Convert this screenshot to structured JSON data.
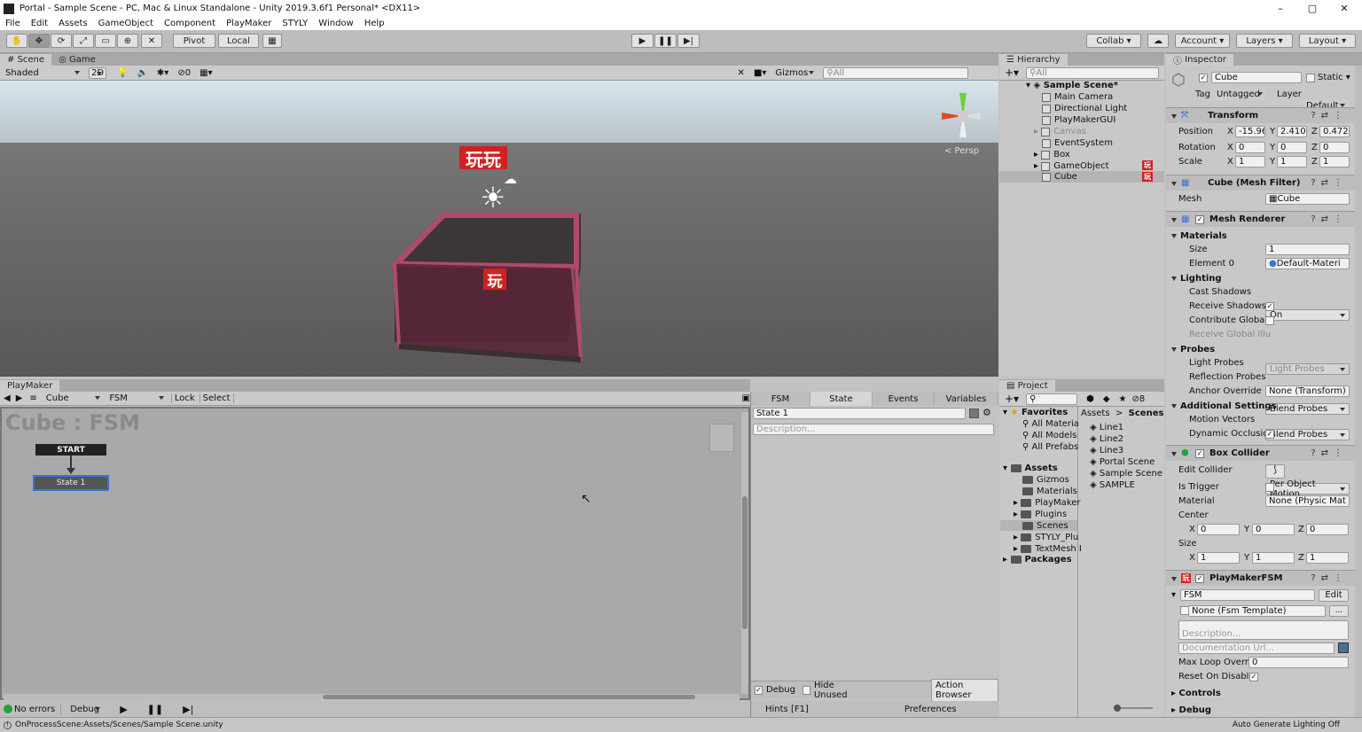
{
  "window": {
    "title": "Portal - Sample Scene - PC, Mac & Linux Standalone - Unity 2019.3.6f1 Personal* <DX11>",
    "minimize": "–",
    "maximize": "▢",
    "close": "✕"
  },
  "menu": [
    "File",
    "Edit",
    "Assets",
    "GameObject",
    "Component",
    "PlayMaker",
    "STYLY",
    "Window",
    "Help"
  ],
  "toolbar": {
    "pivot": "Pivot",
    "local": "Local",
    "collab": "Collab",
    "account": "Account",
    "layers": "Layers",
    "layout": "Layout"
  },
  "scene_panel": {
    "tabs": [
      "Scene",
      "Game"
    ],
    "shading": "Shaded",
    "mode2d": "2D",
    "hidden_count": "0",
    "gizmos": "Gizmos",
    "search_placeholder": "All",
    "persp": "< Persp",
    "badge_text": "玩玩",
    "badge_small": "玩"
  },
  "hierarchy": {
    "tab": "Hierarchy",
    "search_placeholder": "All",
    "scene": "Sample Scene*",
    "items": [
      "Main Camera",
      "Directional Light",
      "PlayMakerGUI",
      "Canvas",
      "EventSystem",
      "Box",
      "GameObject",
      "Cube"
    ],
    "badge": "玩"
  },
  "project": {
    "tab": "Project",
    "favorites": "Favorites",
    "fav_items": [
      "All Materia",
      "All Models",
      "All Prefabs"
    ],
    "assets": "Assets",
    "asset_folders": [
      "Gizmos",
      "Materials",
      "PlayMaker",
      "Plugins",
      "Scenes",
      "STYLY_Plu",
      "TextMesh I"
    ],
    "packages": "Packages",
    "breadcrumb_root": "Assets",
    "breadcrumb_sep": ">",
    "breadcrumb_leaf": "Scenes",
    "files": [
      "Line1",
      "Line2",
      "Line3",
      "Portal Scene",
      "Sample Scene",
      "SAMPLE"
    ],
    "count": "8"
  },
  "playmaker": {
    "tab": "PlayMaker",
    "object": "Cube",
    "fsm": "FSM",
    "lock": "Lock",
    "select": "Select",
    "graph_title": "Cube : FSM",
    "start": "START",
    "state": "State 1",
    "tabs": [
      "FSM",
      "State",
      "Events",
      "Variables"
    ],
    "state_name": "State 1",
    "description_placeholder": "Description...",
    "debug": "Debug",
    "hide_unused": "Hide Unused",
    "action_browser": "Action Browser",
    "hints": "Hints [F1]",
    "preferences": "Preferences",
    "no_errors": "No errors",
    "debug_menu": "Debug"
  },
  "inspector": {
    "tab": "Inspector",
    "object_name": "Cube",
    "static": "Static",
    "tag_label": "Tag",
    "tag": "Untagged",
    "layer_label": "Layer",
    "layer": "Default",
    "transform": {
      "title": "Transform",
      "position": "Position",
      "rotation": "Rotation",
      "scale": "Scale",
      "pos": [
        "-15.96",
        "2.4104",
        "0.4723"
      ],
      "rot": [
        "0",
        "0",
        "0"
      ],
      "scl": [
        "1",
        "1",
        "1"
      ]
    },
    "mesh_filter": {
      "title": "Cube (Mesh Filter)",
      "mesh_label": "Mesh",
      "mesh": "Cube"
    },
    "mesh_renderer": {
      "title": "Mesh Renderer",
      "materials": "Materials",
      "size_label": "Size",
      "size": "1",
      "element0_label": "Element 0",
      "element0": "Default-Materi",
      "lighting": "Lighting",
      "cast_shadows_label": "Cast Shadows",
      "cast_shadows": "On",
      "receive_shadows": "Receive Shadows",
      "contribute_gi": "Contribute Global I",
      "receive_gi_label": "Receive Global Illu",
      "receive_gi": "Light Probes",
      "probes": "Probes",
      "light_probes_label": "Light Probes",
      "light_probes": "Blend Probes",
      "reflection_probes_label": "Reflection Probes",
      "reflection_probes": "Blend Probes",
      "anchor_override_label": "Anchor Override",
      "anchor_override": "None (Transform)",
      "additional": "Additional Settings",
      "motion_vectors_label": "Motion Vectors",
      "motion_vectors": "Per Object Motion",
      "dynamic_occlusion": "Dynamic Occlusio"
    },
    "box_collider": {
      "title": "Box Collider",
      "edit_collider": "Edit Collider",
      "is_trigger": "Is Trigger",
      "material_label": "Material",
      "material": "None (Physic Mat",
      "center": "Center",
      "center_vals": [
        "0",
        "0",
        "0"
      ],
      "size": "Size",
      "size_vals": [
        "1",
        "1",
        "1"
      ]
    },
    "playmaker_fsm": {
      "title": "PlayMakerFSM",
      "fsm_name": "FSM",
      "edit": "Edit",
      "template": "None (Fsm Template)",
      "more": "...",
      "description_placeholder": "Description...",
      "doc_url_placeholder": "Documentation Url...",
      "max_loop_label": "Max Loop Overric",
      "max_loop": "0",
      "reset_on_disable": "Reset On Disable"
    },
    "controls": "Controls",
    "debug": "Debug",
    "auto_lighting": "Auto Generate Lighting Off"
  },
  "status": {
    "message": "OnProcessScene:Assets/Scenes/Sample Scene.unity"
  },
  "axes": {
    "x": "X",
    "y": "Y",
    "z": "Z"
  },
  "colors": {
    "accent": "#3a72d8",
    "badge_red": "#d32020",
    "box_edge": "#b04a6a"
  }
}
